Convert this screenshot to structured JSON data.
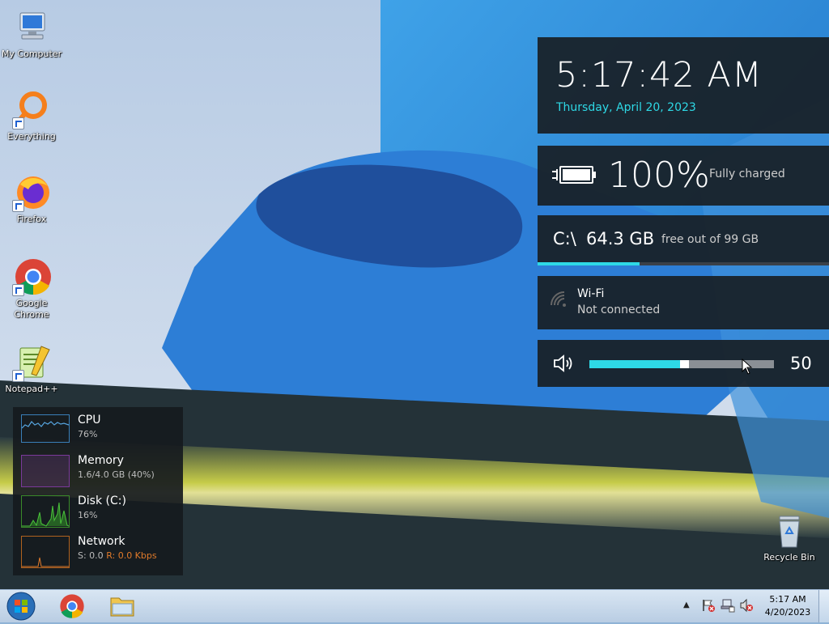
{
  "desktop": {
    "icons": [
      {
        "label": "My Computer",
        "icon": "computer-icon"
      },
      {
        "label": "Everything",
        "icon": "everything-icon"
      },
      {
        "label": "Firefox",
        "icon": "firefox-icon"
      },
      {
        "label": "Google Chrome",
        "icon": "chrome-icon"
      },
      {
        "label": "Notepad++",
        "icon": "notepadpp-icon"
      },
      {
        "label": "Recycle Bin",
        "icon": "recycle-bin-icon"
      }
    ]
  },
  "widgets": {
    "clock": {
      "time": "5:17:42 AM",
      "date": "Thursday, April 20, 2023"
    },
    "battery": {
      "percent": "100%",
      "status": "Fully charged",
      "level": 1.0
    },
    "disk": {
      "drive": "C:\\",
      "free": "64.3 GB",
      "detail": "free out of 99 GB",
      "used_fraction": 0.35
    },
    "wifi": {
      "name": "Wi-Fi",
      "status": "Not connected"
    },
    "volume": {
      "value": "50",
      "level": 0.5
    }
  },
  "meters": [
    {
      "name": "CPU",
      "value": "76%"
    },
    {
      "name": "Memory",
      "value": "1.6/4.0 GB (40%)"
    },
    {
      "name": "Disk (C:)",
      "value": "16%"
    },
    {
      "name": "Network",
      "value_send": "S: 0.0",
      "value_recv": "R: 0.0 Kbps"
    }
  ],
  "taskbar": {
    "clock_time": "5:17 AM",
    "clock_date": "4/20/2023"
  },
  "colors": {
    "accent": "#2ed9e6",
    "tile": "#181e24",
    "cpu": "#3a7fb8",
    "memory": "#7a3a9a",
    "disk": "#3a8a2a",
    "network": "#b0621f"
  }
}
